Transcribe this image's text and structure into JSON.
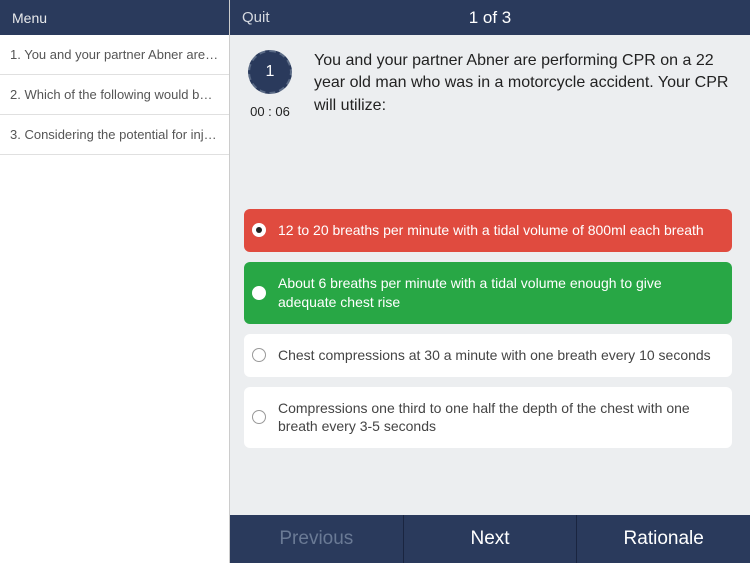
{
  "sidebar": {
    "menu_label": "Menu",
    "items": [
      {
        "label": "1. You and your partner Abner are…"
      },
      {
        "label": "2. Which of the following would be…"
      },
      {
        "label": "3. Considering the potential for inj…"
      }
    ]
  },
  "header": {
    "quit_label": "Quit",
    "progress": "1 of 3"
  },
  "question": {
    "number": "1",
    "timer": "00 : 06",
    "text": "You and your partner Abner are performing CPR on a 22 year old man who was in a motorcycle accident. Your CPR will utilize:"
  },
  "answers": [
    {
      "text": "12 to 20 breaths per minute with a tidal volume of 800ml each breath",
      "state": "red"
    },
    {
      "text": "About 6 breaths per minute with a tidal volume enough to give adequate chest rise",
      "state": "green"
    },
    {
      "text": "Chest compressions at 30 a minute with one breath every 10 seconds",
      "state": "plain"
    },
    {
      "text": "Compressions one third to one half the depth of the chest with one breath every 3-5 seconds",
      "state": "plain"
    }
  ],
  "footer": {
    "previous": "Previous",
    "next": "Next",
    "rationale": "Rationale"
  }
}
